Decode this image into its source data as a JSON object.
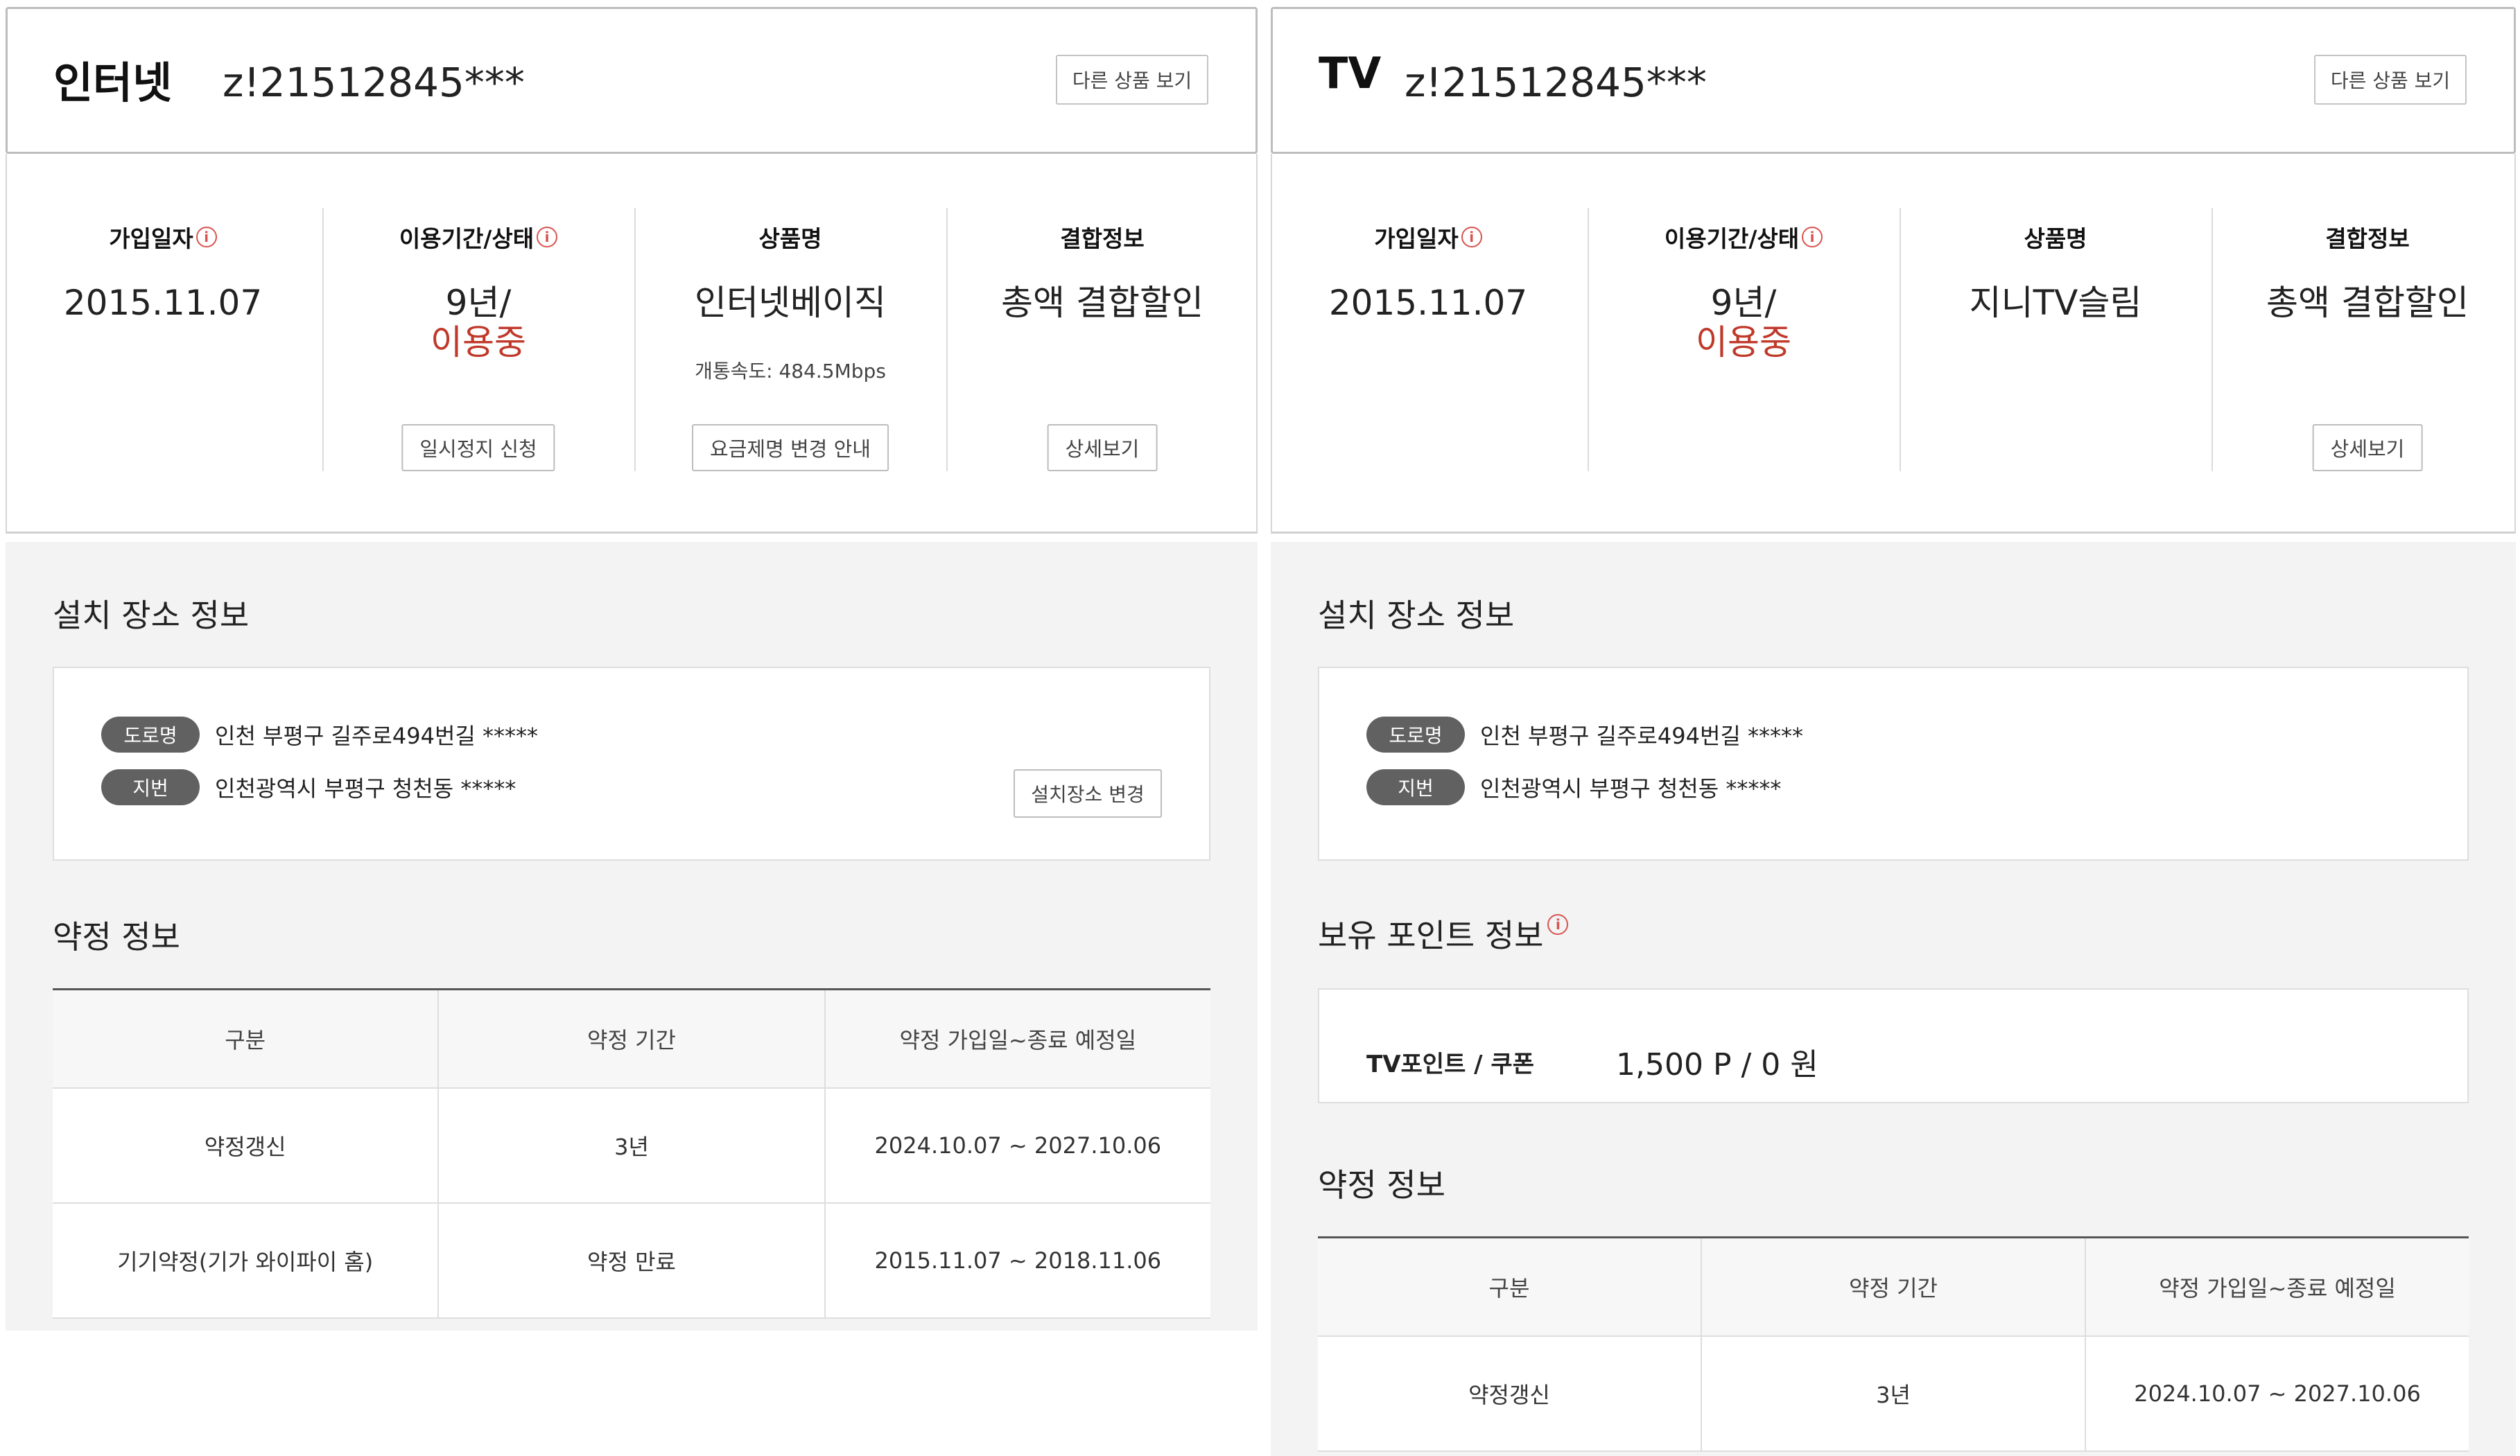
{
  "internet": {
    "title": "인터넷",
    "account": "z!21512845***",
    "other_products_btn": "다른 상품 보기",
    "summary": {
      "join_date_label": "가입일자",
      "join_date": "2015.11.07",
      "period_label": "이용기간/상태",
      "period": "9년/",
      "status": "이용중",
      "pause_btn": "일시정지 신청",
      "product_label": "상품명",
      "product": "인터넷베이직",
      "speed": "개통속도: 484.5Mbps",
      "plan_change_btn": "요금제명 변경 안내",
      "combo_label": "결합정보",
      "combo": "총액 결합할인",
      "detail_btn": "상세보기"
    },
    "install": {
      "title": "설치 장소 정보",
      "road_tag": "도로명",
      "road_addr": "인천 부평구 길주로494번길 *****",
      "lot_tag": "지번",
      "lot_addr": "인천광역시 부평구 청천동 *****",
      "change_btn": "설치장소 변경"
    },
    "contract": {
      "title": "약정 정보",
      "headers": [
        "구분",
        "약정 기간",
        "약정 가입일~종료 예정일"
      ],
      "rows": [
        [
          "약정갱신",
          "3년",
          "2024.10.07 ~ 2027.10.06"
        ],
        [
          "기기약정(기가 와이파이 홈)",
          "약정 만료",
          "2015.11.07 ~ 2018.11.06"
        ]
      ]
    }
  },
  "tv": {
    "title": "TV",
    "account": "z!21512845***",
    "other_products_btn": "다른 상품 보기",
    "summary": {
      "join_date_label": "가입일자",
      "join_date": "2015.11.07",
      "period_label": "이용기간/상태",
      "period": "9년/",
      "status": "이용중",
      "product_label": "상품명",
      "product": "지니TV슬림",
      "combo_label": "결합정보",
      "combo": "총액 결합할인",
      "detail_btn": "상세보기"
    },
    "install": {
      "title": "설치 장소 정보",
      "road_tag": "도로명",
      "road_addr": "인천 부평구 길주로494번길 *****",
      "lot_tag": "지번",
      "lot_addr": "인천광역시 부평구 청천동 *****"
    },
    "points": {
      "title": "보유 포인트 정보",
      "label": "TV포인트 / 쿠폰",
      "value": "1,500 P / 0 원"
    },
    "contract": {
      "title": "약정 정보",
      "headers": [
        "구분",
        "약정 기간",
        "약정 가입일~종료 예정일"
      ],
      "rows": [
        [
          "약정갱신",
          "3년",
          "2024.10.07 ~ 2027.10.06"
        ]
      ]
    }
  },
  "colors": {
    "accent_red": "#c0392b",
    "tag_gray": "#616161",
    "section_bg": "#f3f3f3"
  },
  "icons": {
    "info": "info-circle-icon"
  }
}
